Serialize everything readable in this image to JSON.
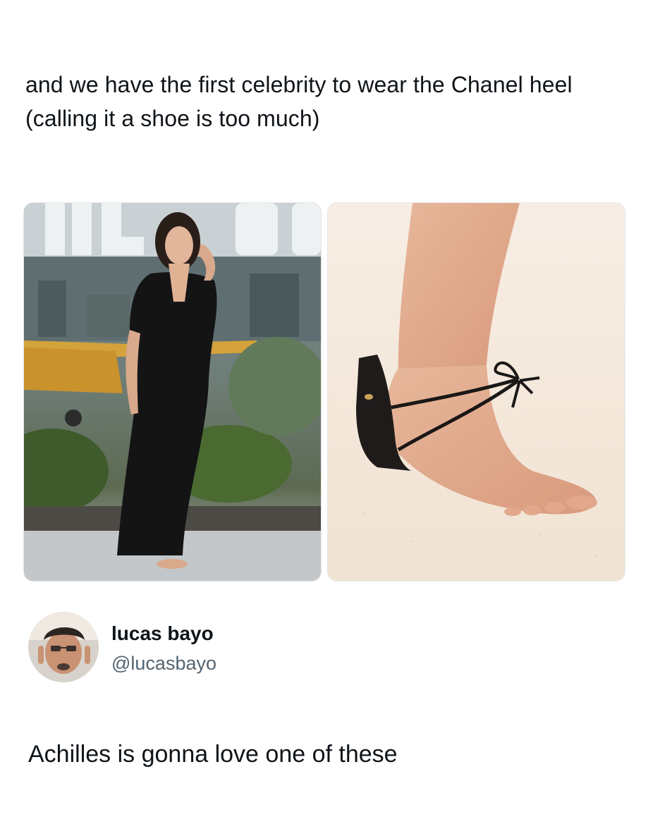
{
  "post": {
    "text": "and we have the first celebrity to wear the Chanel heel (calling it a shoe is too much)"
  },
  "images": [
    {
      "name": "celebrity-photo",
      "description_icon": "photo-icon"
    },
    {
      "name": "chanel-heel-photo",
      "description_icon": "photo-icon"
    }
  ],
  "author": {
    "display_name": "lucas bayo",
    "handle": "@lucasbayo"
  },
  "reply": {
    "text": "Achilles is gonna love one of these"
  },
  "colors": {
    "text": "#0f1419",
    "handle": "#536471",
    "background": "#ffffff"
  }
}
